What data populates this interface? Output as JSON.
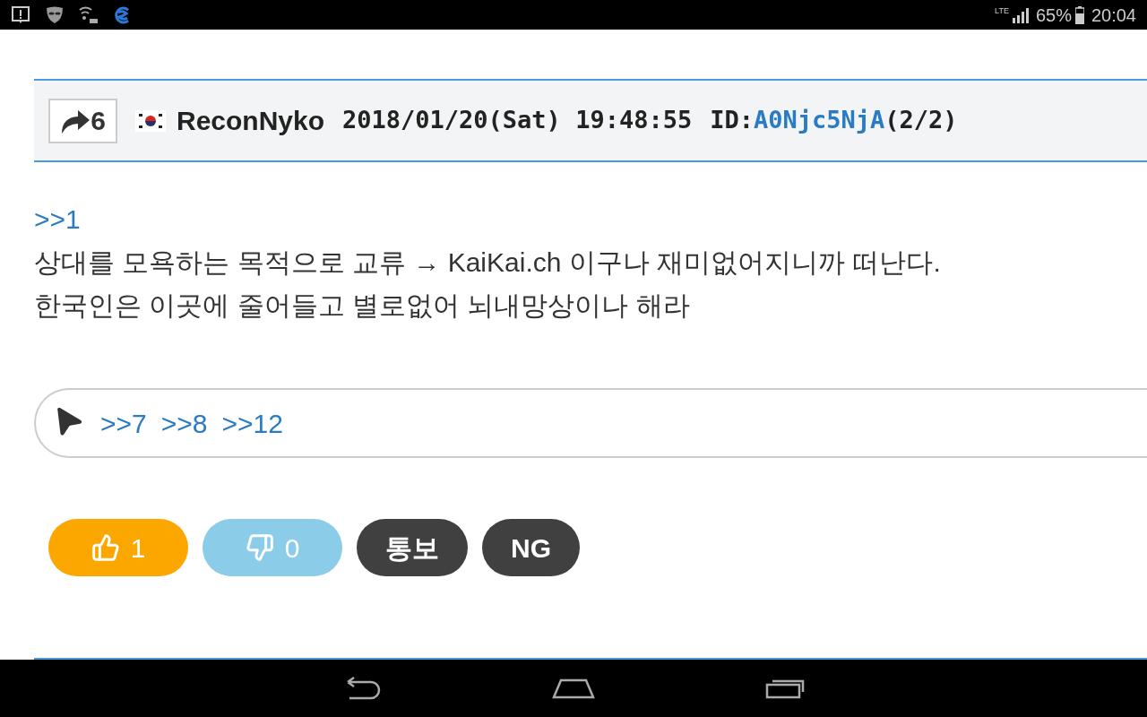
{
  "status_bar": {
    "network": "LTE",
    "battery": "65%",
    "time": "20:04"
  },
  "post": {
    "share_count": "6",
    "author": "ReconNyko",
    "date": "2018/01/20(Sat) 19:48:55",
    "id_label": "ID:",
    "id": "A0Njc5NjA",
    "id_count": "(2/2)",
    "reply_to": ">>1",
    "lines": [
      "상대를 모욕하는 목적으로 교류 → KaiKai.ch 이구나 재미없어지니까 떠난다.",
      "한국인은 이곳에 줄어들고 별로없어 뇌내망상이나 해라"
    ],
    "replies": [
      ">>7",
      ">>8",
      ">>12"
    ],
    "buttons": [
      {
        "kind": "like",
        "label": "1"
      },
      {
        "kind": "dislike",
        "label": "0"
      },
      {
        "kind": "text",
        "label": "통보"
      },
      {
        "kind": "text",
        "label": "NG"
      }
    ]
  }
}
